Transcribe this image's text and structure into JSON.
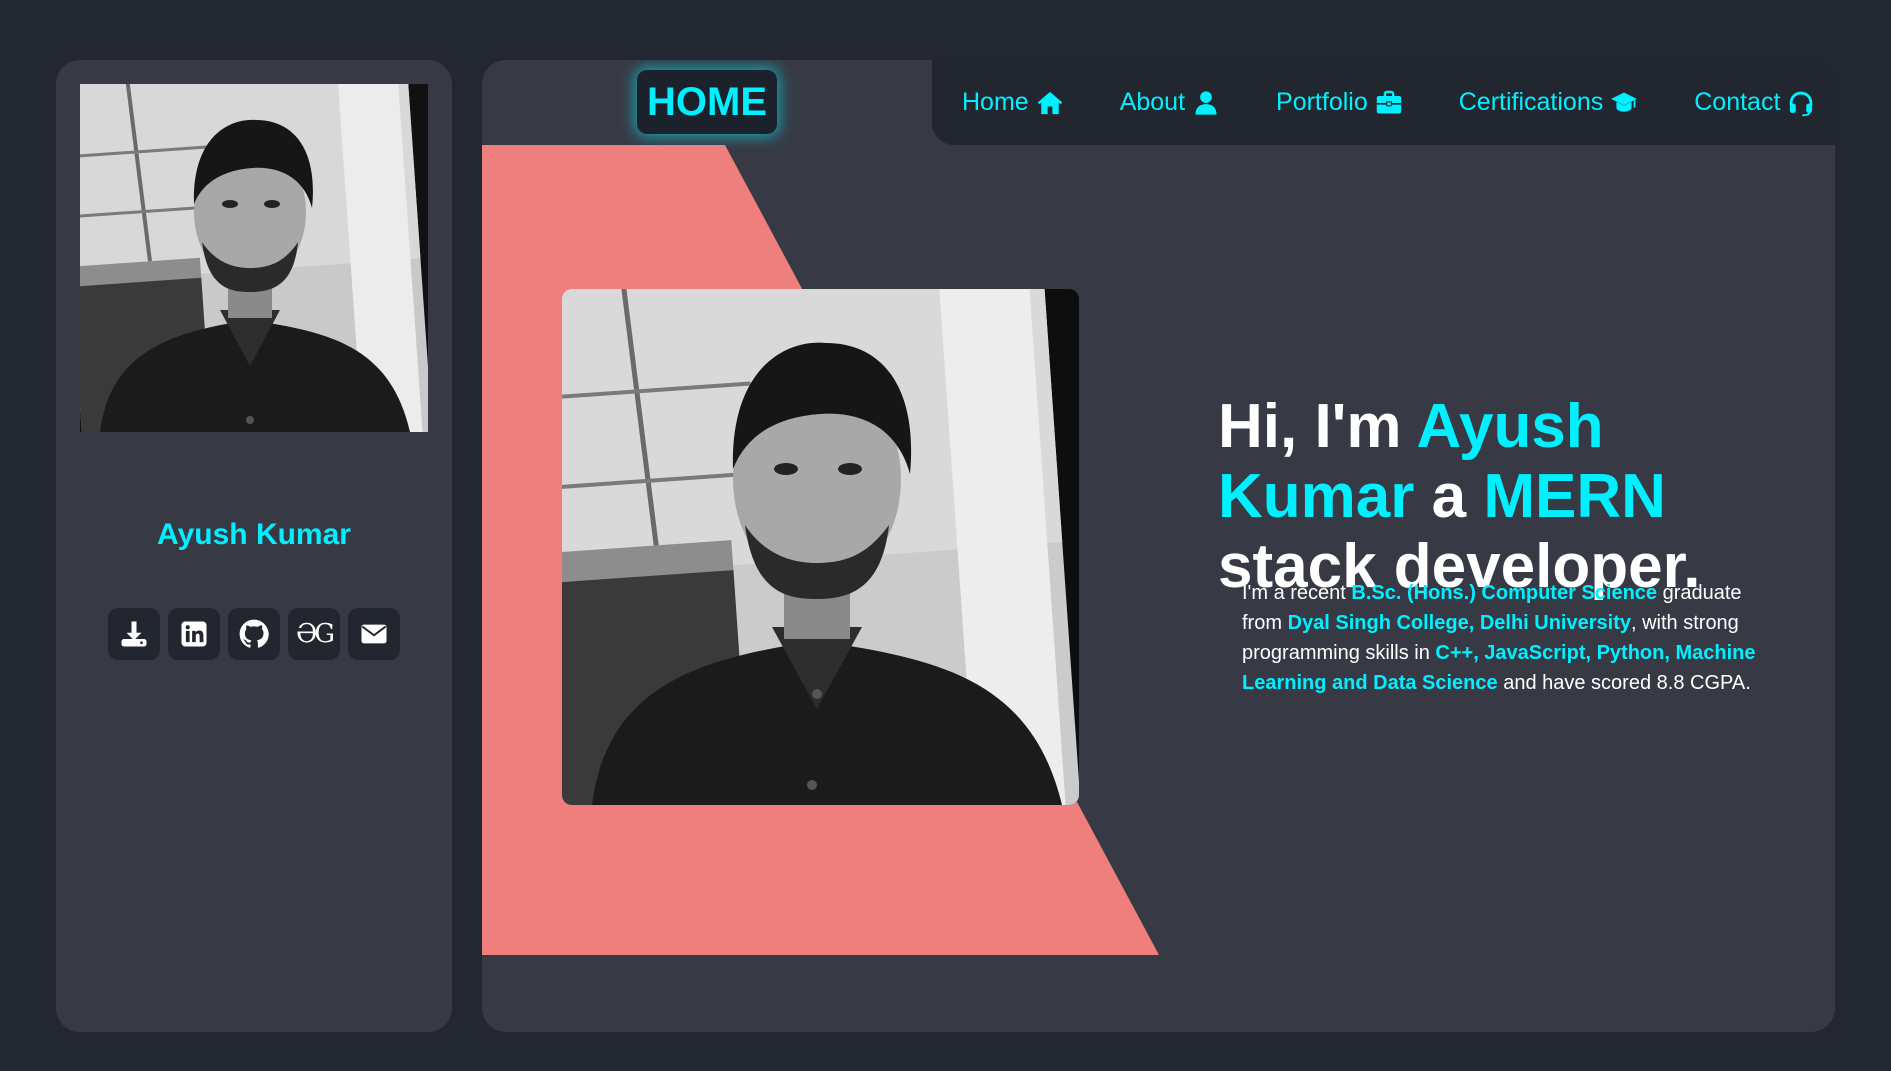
{
  "sidebar": {
    "name": "Ayush Kumar",
    "social_icons": [
      "download-icon",
      "linkedin-icon",
      "github-icon",
      "geeksforgeeks-icon",
      "mail-icon"
    ],
    "gfg_glyph": "ƏG"
  },
  "header": {
    "badge": "HOME",
    "nav": [
      {
        "label": "Home",
        "icon": "house-icon"
      },
      {
        "label": "About",
        "icon": "user-icon"
      },
      {
        "label": "Portfolio",
        "icon": "briefcase-icon"
      },
      {
        "label": "Certifications",
        "icon": "graduation-cap-icon"
      },
      {
        "label": "Contact",
        "icon": "headset-icon"
      }
    ]
  },
  "hero": {
    "greeting": "Hi, I'm ",
    "name_line1": "Ayush",
    "name_line2": "Kumar",
    "connector": " a ",
    "role_highlight": "MERN",
    "role_rest": "stack developer.",
    "bio": {
      "t1": "I'm a recent ",
      "degree": "B.Sc. (Hons.) Computer Science",
      "t2": " graduate from ",
      "college": "Dyal Singh College, Delhi University",
      "t3": ", with strong programming skills in ",
      "skills": "C++, JavaScript, Python, Machine Learning and Data Science",
      "t4": " and have scored 8.8 CGPA."
    }
  },
  "colors": {
    "accent": "#00f0ff",
    "page_bg": "#222731",
    "panel_bg": "#373a45",
    "dark_bg": "#22262f",
    "salmon": "#ef7f7c",
    "text": "#ffffff"
  }
}
